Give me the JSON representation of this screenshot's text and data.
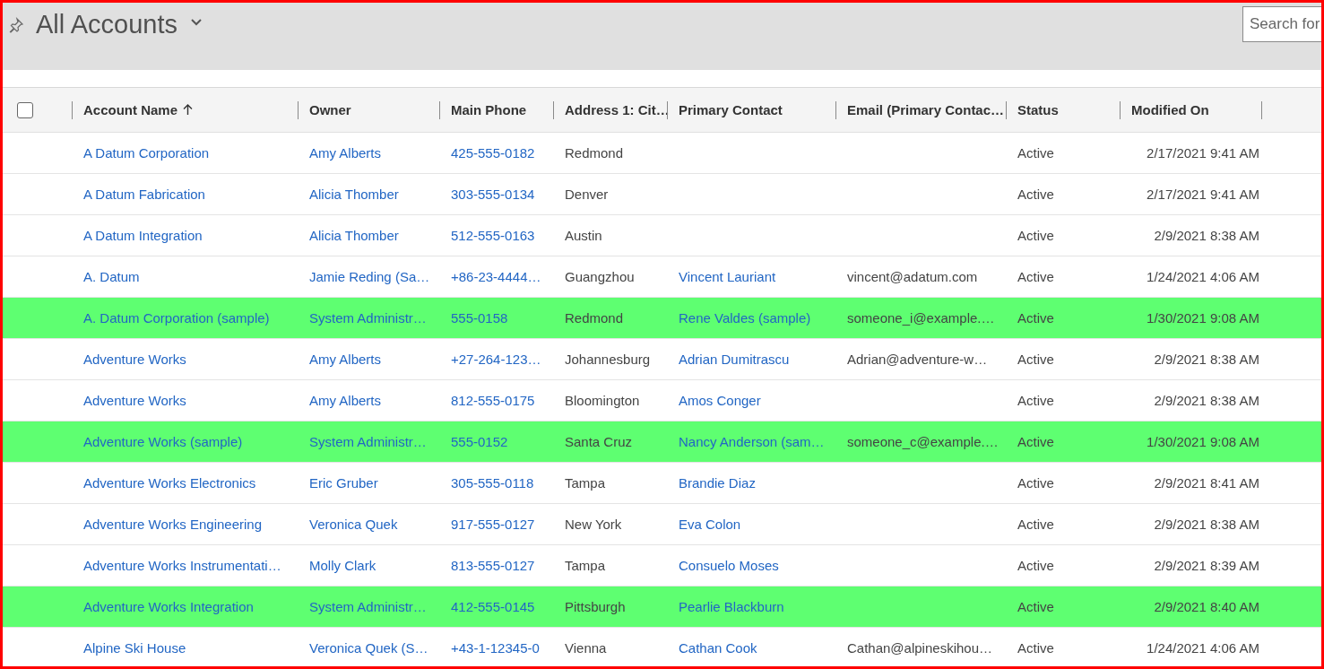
{
  "view": {
    "title": "All Accounts"
  },
  "search": {
    "placeholder": "Search for"
  },
  "grid": {
    "select_all": {
      "checked": false
    },
    "columns": [
      {
        "label": "Account Name",
        "sorted": true
      },
      {
        "label": "Owner",
        "sorted": false
      },
      {
        "label": "Main Phone",
        "sorted": false
      },
      {
        "label": "Address 1: Cit…",
        "sorted": false
      },
      {
        "label": "Primary Contact",
        "sorted": false
      },
      {
        "label": "Email (Primary Contac…",
        "sorted": false
      },
      {
        "label": "Status",
        "sorted": false
      },
      {
        "label": "Modified On",
        "sorted": false
      }
    ],
    "rows": [
      {
        "highlighted": false,
        "account_name": "A Datum Corporation",
        "owner": "Amy Alberts",
        "main_phone": "425-555-0182",
        "city": "Redmond",
        "status": "Active",
        "modified_on": "2/17/2021 9:41 AM"
      },
      {
        "highlighted": false,
        "account_name": "A Datum Fabrication",
        "owner": "Alicia Thomber",
        "main_phone": "303-555-0134",
        "city": "Denver",
        "status": "Active",
        "modified_on": "2/17/2021 9:41 AM"
      },
      {
        "highlighted": false,
        "account_name": "A Datum Integration",
        "owner": "Alicia Thomber",
        "main_phone": "512-555-0163",
        "city": "Austin",
        "status": "Active",
        "modified_on": "2/9/2021 8:38 AM"
      },
      {
        "highlighted": false,
        "account_name": "A. Datum",
        "owner": "Jamie Reding (Sa…",
        "main_phone": "+86-23-4444…",
        "city": "Guangzhou",
        "primary_contact": "Vincent Lauriant",
        "email": "vincent@adatum.com",
        "status": "Active",
        "modified_on": "1/24/2021 4:06 AM"
      },
      {
        "highlighted": true,
        "account_name": "A. Datum Corporation (sample)",
        "owner": "System Administr…",
        "main_phone": "555-0158",
        "city": "Redmond",
        "primary_contact": "Rene Valdes (sample)",
        "email": "someone_i@example.…",
        "status": "Active",
        "modified_on": "1/30/2021 9:08 AM"
      },
      {
        "highlighted": false,
        "account_name": "Adventure Works",
        "owner": "Amy Alberts",
        "main_phone": "+27-264-123…",
        "city": "Johannesburg",
        "primary_contact": "Adrian Dumitrascu",
        "email": "Adrian@adventure-w…",
        "status": "Active",
        "modified_on": "2/9/2021 8:38 AM"
      },
      {
        "highlighted": false,
        "account_name": "Adventure Works",
        "owner": "Amy Alberts",
        "main_phone": "812-555-0175",
        "city": "Bloomington",
        "primary_contact": "Amos Conger",
        "status": "Active",
        "modified_on": "2/9/2021 8:38 AM"
      },
      {
        "highlighted": true,
        "account_name": "Adventure Works (sample)",
        "owner": "System Administr…",
        "main_phone": "555-0152",
        "city": "Santa Cruz",
        "primary_contact": "Nancy Anderson (sam…",
        "email": "someone_c@example.…",
        "status": "Active",
        "modified_on": "1/30/2021 9:08 AM"
      },
      {
        "highlighted": false,
        "account_name": "Adventure Works Electronics",
        "owner": "Eric Gruber",
        "main_phone": "305-555-0118",
        "city": "Tampa",
        "primary_contact": "Brandie Diaz",
        "status": "Active",
        "modified_on": "2/9/2021 8:41 AM"
      },
      {
        "highlighted": false,
        "account_name": "Adventure Works Engineering",
        "owner": "Veronica Quek",
        "main_phone": "917-555-0127",
        "city": "New York",
        "primary_contact": "Eva Colon",
        "status": "Active",
        "modified_on": "2/9/2021 8:38 AM"
      },
      {
        "highlighted": false,
        "account_name": "Adventure Works Instrumentati…",
        "owner": "Molly Clark",
        "main_phone": "813-555-0127",
        "city": "Tampa",
        "primary_contact": "Consuelo Moses",
        "status": "Active",
        "modified_on": "2/9/2021 8:39 AM"
      },
      {
        "highlighted": true,
        "account_name": "Adventure Works Integration",
        "owner": "System Administr…",
        "main_phone": "412-555-0145",
        "city": "Pittsburgh",
        "primary_contact": "Pearlie Blackburn",
        "status": "Active",
        "modified_on": "2/9/2021 8:40 AM"
      },
      {
        "highlighted": false,
        "account_name": "Alpine Ski House",
        "owner": "Veronica Quek (S…",
        "main_phone": "+43-1-12345-0",
        "city": "Vienna",
        "primary_contact": "Cathan Cook",
        "email": "Cathan@alpineskihou…",
        "status": "Active",
        "modified_on": "1/24/2021 4:06 AM"
      }
    ]
  }
}
